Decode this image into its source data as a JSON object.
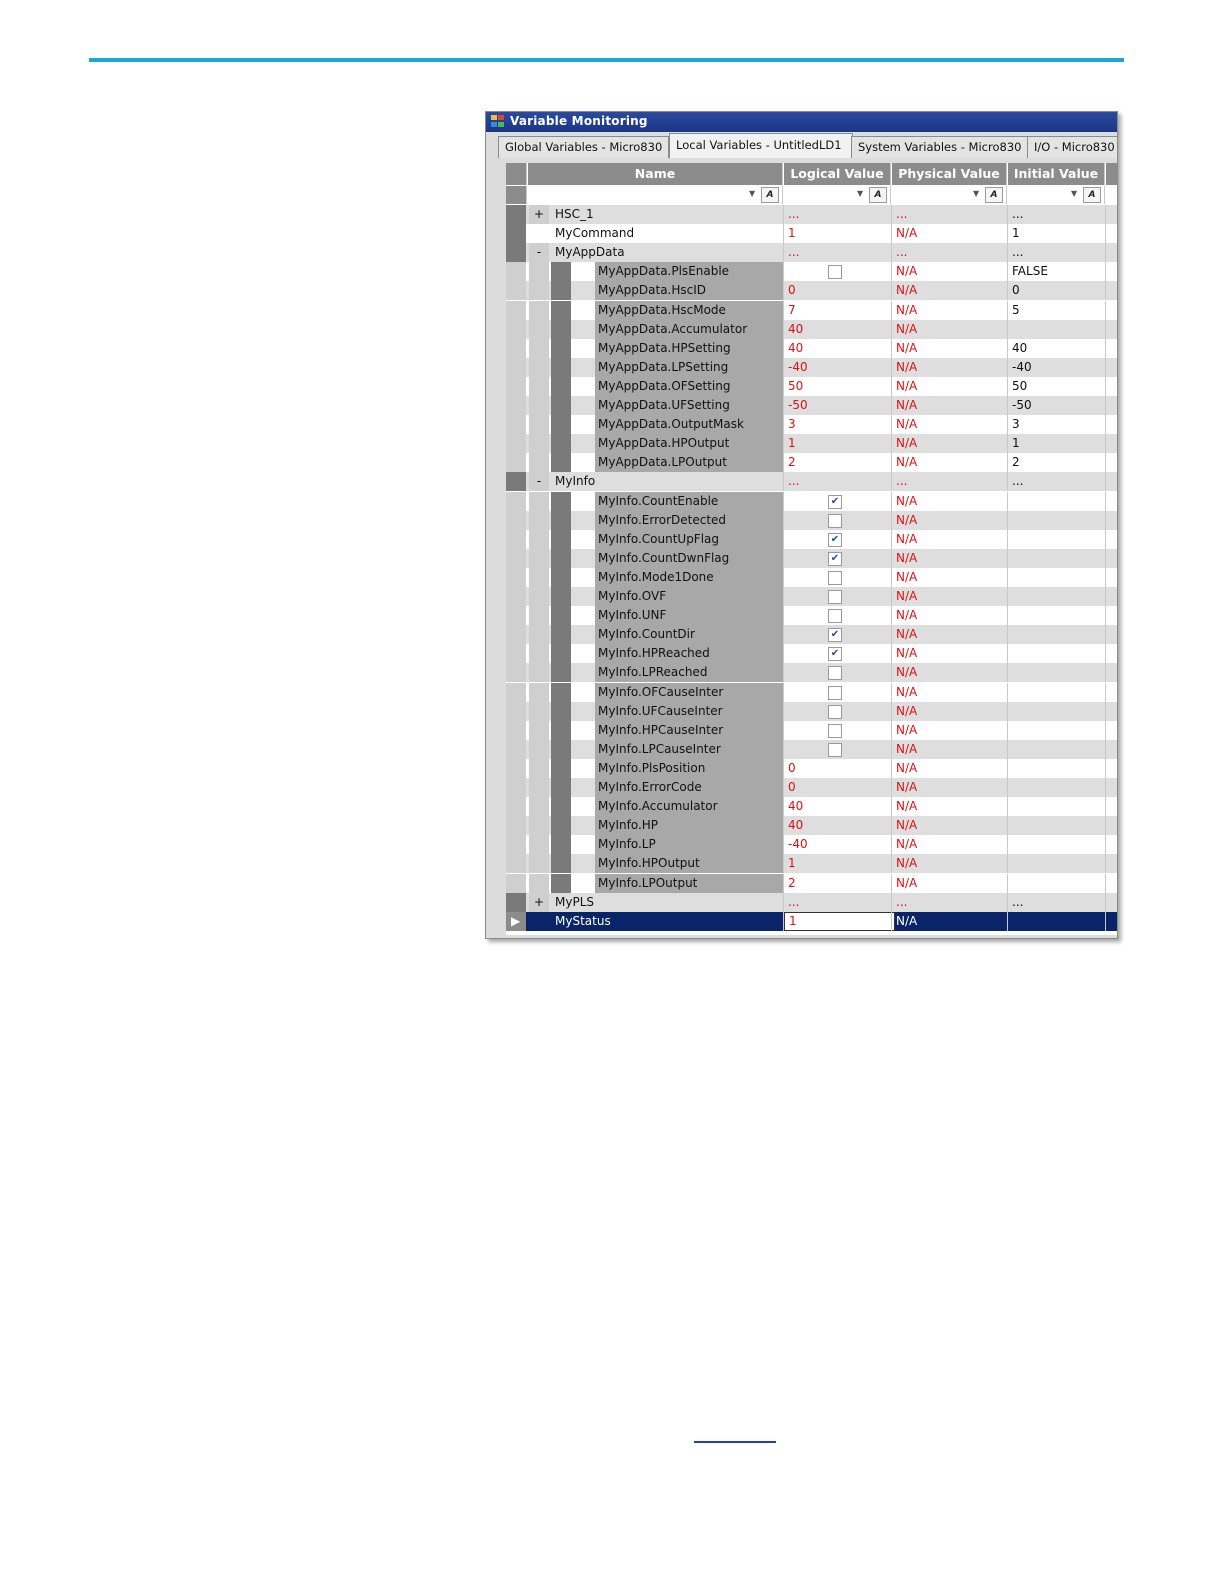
{
  "window": {
    "title": "Variable Monitoring"
  },
  "tabs": [
    {
      "label": "Global Variables - Micro830",
      "active": false
    },
    {
      "label": "Local Variables - UntitledLD1",
      "active": true
    },
    {
      "label": "System Variables - Micro830",
      "active": false
    },
    {
      "label": "I/O - Micro830",
      "active": false
    }
  ],
  "columns": [
    "Name",
    "Logical Value",
    "Physical Value",
    "Initial Value"
  ],
  "rows": [
    {
      "level": 0,
      "expander": "+",
      "name": "HSC_1",
      "logical": "...",
      "physical": "...",
      "initial": "..."
    },
    {
      "level": 0,
      "expander": "",
      "name": "MyCommand",
      "logical": "1",
      "physical": "N/A",
      "initial": "1"
    },
    {
      "level": 0,
      "expander": "-",
      "name": "MyAppData",
      "logical": "...",
      "physical": "...",
      "initial": "..."
    },
    {
      "level": 1,
      "name": "MyAppData.PlsEnable",
      "checkbox": false,
      "physical": "N/A",
      "initial": "FALSE"
    },
    {
      "level": 1,
      "name": "MyAppData.HscID",
      "logical": "0",
      "physical": "N/A",
      "initial": "0"
    },
    {
      "level": 1,
      "name": "MyAppData.HscMode",
      "logical": "7",
      "physical": "N/A",
      "initial": "5"
    },
    {
      "level": 1,
      "name": "MyAppData.Accumulator",
      "logical": "40",
      "physical": "N/A",
      "initial": ""
    },
    {
      "level": 1,
      "name": "MyAppData.HPSetting",
      "logical": "40",
      "physical": "N/A",
      "initial": "40"
    },
    {
      "level": 1,
      "name": "MyAppData.LPSetting",
      "logical": "-40",
      "physical": "N/A",
      "initial": "-40"
    },
    {
      "level": 1,
      "name": "MyAppData.OFSetting",
      "logical": "50",
      "physical": "N/A",
      "initial": "50"
    },
    {
      "level": 1,
      "name": "MyAppData.UFSetting",
      "logical": "-50",
      "physical": "N/A",
      "initial": "-50"
    },
    {
      "level": 1,
      "name": "MyAppData.OutputMask",
      "logical": "3",
      "physical": "N/A",
      "initial": "3"
    },
    {
      "level": 1,
      "name": "MyAppData.HPOutput",
      "logical": "1",
      "physical": "N/A",
      "initial": "1"
    },
    {
      "level": 1,
      "name": "MyAppData.LPOutput",
      "logical": "2",
      "physical": "N/A",
      "initial": "2"
    },
    {
      "level": 0,
      "expander": "-",
      "name": "MyInfo",
      "logical": "...",
      "physical": "...",
      "initial": "..."
    },
    {
      "level": 1,
      "name": "MyInfo.CountEnable",
      "checkbox": true,
      "physical": "N/A",
      "initial": ""
    },
    {
      "level": 1,
      "name": "MyInfo.ErrorDetected",
      "checkbox": false,
      "physical": "N/A",
      "initial": ""
    },
    {
      "level": 1,
      "name": "MyInfo.CountUpFlag",
      "checkbox": true,
      "physical": "N/A",
      "initial": ""
    },
    {
      "level": 1,
      "name": "MyInfo.CountDwnFlag",
      "checkbox": true,
      "physical": "N/A",
      "initial": ""
    },
    {
      "level": 1,
      "name": "MyInfo.Mode1Done",
      "checkbox": false,
      "physical": "N/A",
      "initial": ""
    },
    {
      "level": 1,
      "name": "MyInfo.OVF",
      "checkbox": false,
      "physical": "N/A",
      "initial": ""
    },
    {
      "level": 1,
      "name": "MyInfo.UNF",
      "checkbox": false,
      "physical": "N/A",
      "initial": ""
    },
    {
      "level": 1,
      "name": "MyInfo.CountDir",
      "checkbox": true,
      "physical": "N/A",
      "initial": ""
    },
    {
      "level": 1,
      "name": "MyInfo.HPReached",
      "checkbox": true,
      "physical": "N/A",
      "initial": ""
    },
    {
      "level": 1,
      "name": "MyInfo.LPReached",
      "checkbox": false,
      "physical": "N/A",
      "initial": ""
    },
    {
      "level": 1,
      "name": "MyInfo.OFCauseInter",
      "checkbox": false,
      "physical": "N/A",
      "initial": ""
    },
    {
      "level": 1,
      "name": "MyInfo.UFCauseInter",
      "checkbox": false,
      "physical": "N/A",
      "initial": ""
    },
    {
      "level": 1,
      "name": "MyInfo.HPCauseInter",
      "checkbox": false,
      "physical": "N/A",
      "initial": ""
    },
    {
      "level": 1,
      "name": "MyInfo.LPCauseInter",
      "checkbox": false,
      "physical": "N/A",
      "initial": ""
    },
    {
      "level": 1,
      "name": "MyInfo.PlsPosition",
      "logical": "0",
      "physical": "N/A",
      "initial": ""
    },
    {
      "level": 1,
      "name": "MyInfo.ErrorCode",
      "logical": "0",
      "physical": "N/A",
      "initial": ""
    },
    {
      "level": 1,
      "name": "MyInfo.Accumulator",
      "logical": "40",
      "physical": "N/A",
      "initial": ""
    },
    {
      "level": 1,
      "name": "MyInfo.HP",
      "logical": "40",
      "physical": "N/A",
      "initial": ""
    },
    {
      "level": 1,
      "name": "MyInfo.LP",
      "logical": "-40",
      "physical": "N/A",
      "initial": ""
    },
    {
      "level": 1,
      "name": "MyInfo.HPOutput",
      "logical": "1",
      "physical": "N/A",
      "initial": ""
    },
    {
      "level": 1,
      "name": "MyInfo.LPOutput",
      "logical": "2",
      "physical": "N/A",
      "initial": ""
    },
    {
      "level": 0,
      "expander": "+",
      "name": "MyPLS",
      "logical": "...",
      "physical": "...",
      "initial": "..."
    },
    {
      "level": 0,
      "expander": "",
      "name": "MyStatus",
      "logical": "1",
      "physical": "N/A",
      "initial": "",
      "selected": true
    }
  ],
  "colors": {
    "accent_rule": "#1aa6db",
    "title_bar": "#1d3585",
    "value_red": "#d11111",
    "selected_row": "#0a246a"
  }
}
